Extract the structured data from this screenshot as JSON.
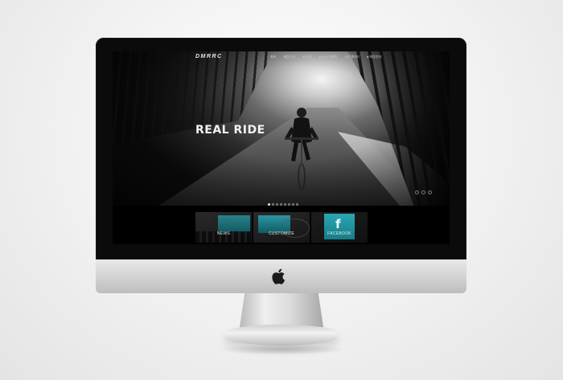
{
  "site": {
    "logo": "DMRRC",
    "nav": [
      {
        "label": "최초"
      },
      {
        "label": "제품구성"
      },
      {
        "label": "커스텀"
      },
      {
        "label": "뉴스 & 이벤트"
      },
      {
        "label": "사진갤러리"
      },
      {
        "label": "● 매장안내"
      }
    ]
  },
  "hero": {
    "title": "REAL RIDE",
    "slide_count": 8,
    "active_slide": 1
  },
  "tiles": [
    {
      "label": "NEWS"
    },
    {
      "label": "CUSTOMIZE"
    },
    {
      "label": "FACEBOOK",
      "glyph": "f"
    }
  ],
  "colors": {
    "accent_teal": "#2aa7b4",
    "nav_dot": "#c0302c"
  }
}
